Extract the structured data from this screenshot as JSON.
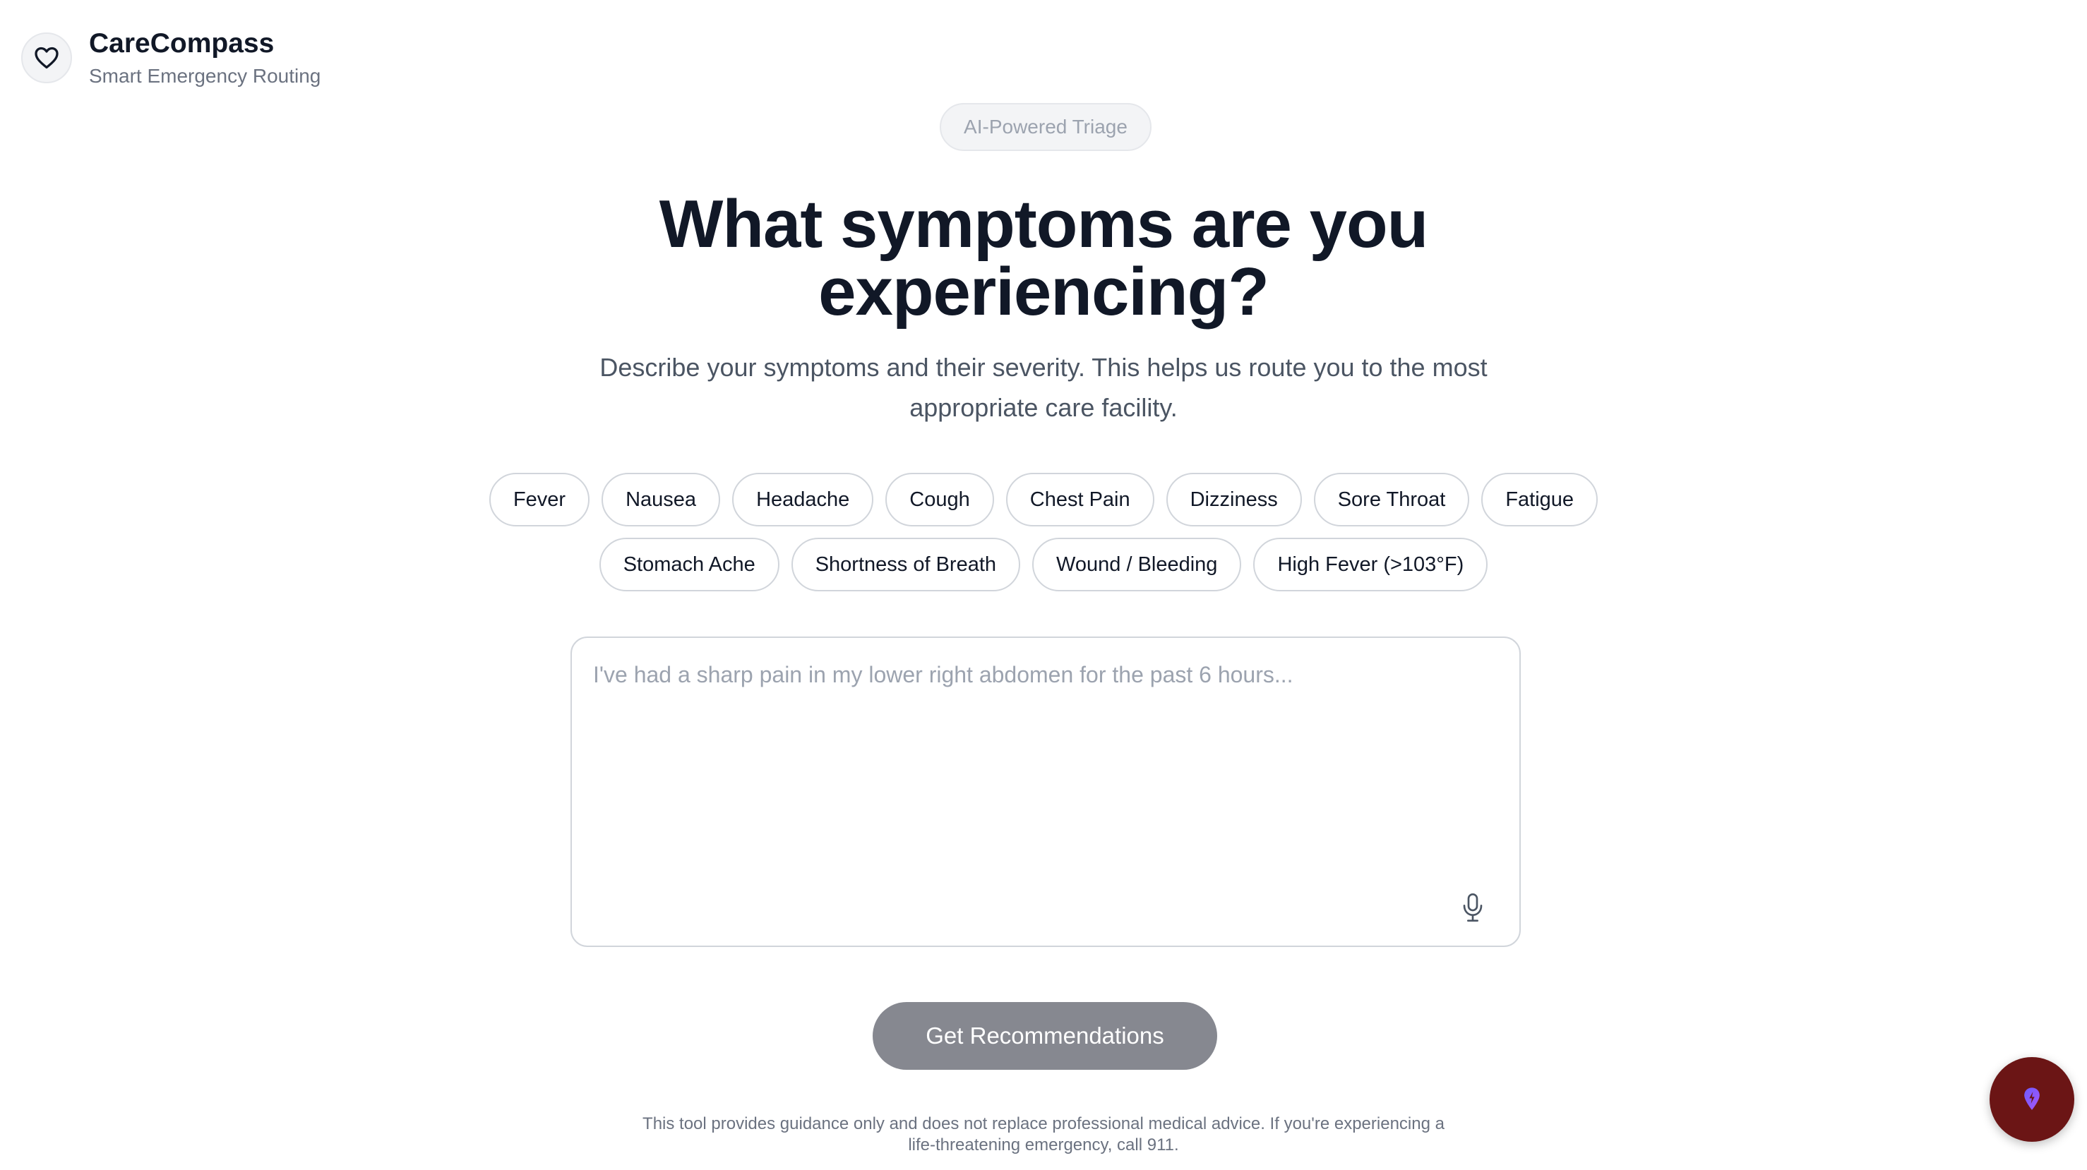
{
  "brand": {
    "title": "CareCompass",
    "subtitle": "Smart Emergency Routing",
    "logo_icon": "heart-icon"
  },
  "badge": {
    "label": "AI-Powered Triage"
  },
  "hero": {
    "heading_line1": "What symptoms are you",
    "heading_line2": "experiencing?",
    "description": "Describe your symptoms and their severity. This helps us route you to the most appropriate care facility."
  },
  "symptoms": {
    "row1": [
      "Fever",
      "Nausea",
      "Headache",
      "Cough",
      "Chest Pain",
      "Dizziness",
      "Sore Throat",
      "Fatigue"
    ],
    "row2": [
      "Stomach Ache",
      "Shortness of Breath",
      "Wound / Bleeding",
      "High Fever (>103°F)"
    ]
  },
  "input": {
    "value": "",
    "placeholder": "I've had a sharp pain in my lower right abdomen for the past 6 hours...",
    "mic_icon": "microphone-icon"
  },
  "cta": {
    "label": "Get Recommendations"
  },
  "disclaimer": {
    "line1": "This tool provides guidance only and does not replace professional medical advice. If you're experiencing a",
    "line2": "life-threatening emergency, call 911."
  },
  "fab": {
    "icon": "assistant-icon"
  },
  "colors": {
    "button_bg": "#868890",
    "fab_bg": "#6b1515",
    "heading": "#111827",
    "muted": "#6b7280"
  }
}
